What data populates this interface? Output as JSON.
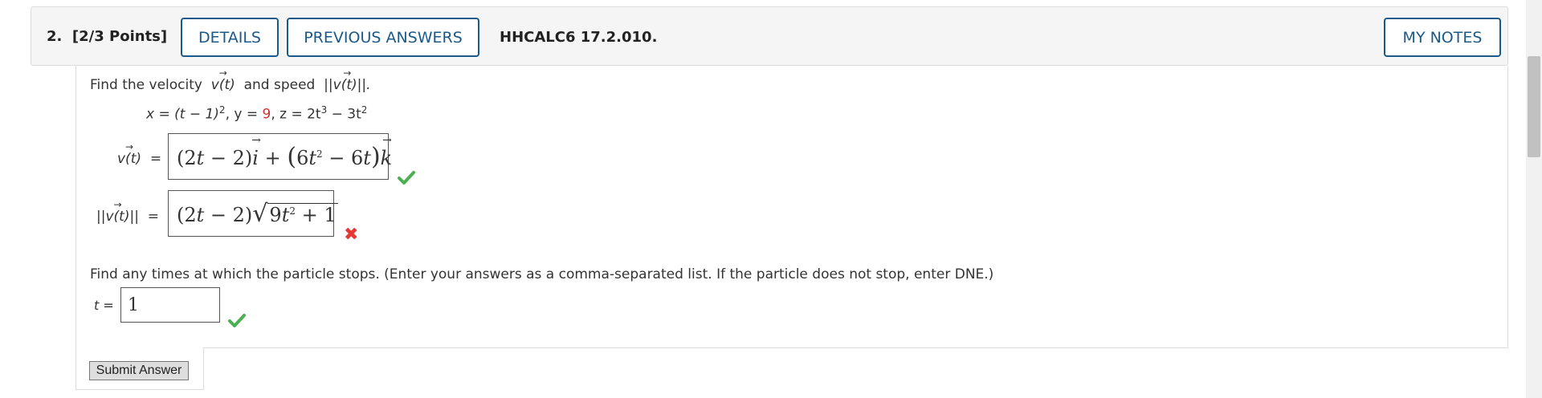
{
  "header": {
    "question_number": "2.",
    "points": "[2/3 Points]",
    "details_label": "DETAILS",
    "previous_answers_label": "PREVIOUS ANSWERS",
    "problem_code": "HHCALC6 17.2.010.",
    "my_notes_label": "MY NOTES"
  },
  "prompt": {
    "find_velocity": "Find the velocity",
    "v_t": "v(t)",
    "and_speed": "and speed",
    "speed": "||v(t)||."
  },
  "equations": {
    "x_part": "x = (t − 1)",
    "y_part": ", y = ",
    "y_value": "9",
    "z_part": ", z = 2t",
    "z_rest": " − 3t"
  },
  "answers": {
    "velocity_label": "v(t)",
    "speed_label": "||v(t)||",
    "equals": "=",
    "velocity_value": "(2t − 2)i + (6t² − 6t)k",
    "speed_value": "(2t − 2)√(9t² + 1)",
    "velocity_status": "correct",
    "speed_status": "incorrect"
  },
  "stops": {
    "instruction": "Find any times at which the particle stops. (Enter your answers as a comma-separated list. If the particle does not stop, enter DNE.)",
    "t_label": "t =",
    "t_value": "1",
    "status": "correct"
  },
  "submit_label": "Submit Answer",
  "colors": {
    "accent": "#1a5a8a",
    "correct": "#4caf50",
    "incorrect": "#e53935",
    "highlight": "#d32f2f"
  },
  "icons": {
    "correct": "check-icon",
    "incorrect": "x-icon"
  }
}
